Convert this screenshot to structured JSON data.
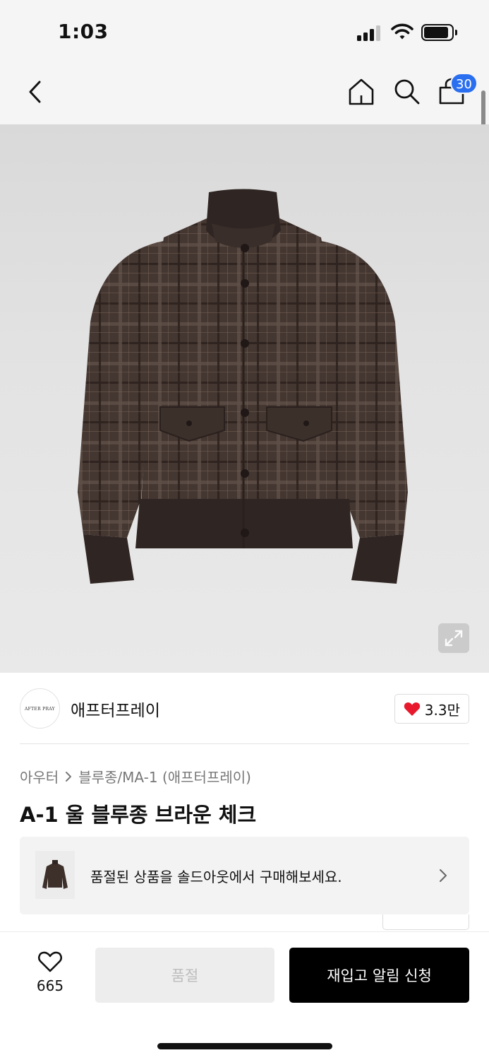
{
  "status_bar": {
    "time": "1:03"
  },
  "nav": {
    "cart_count": "30"
  },
  "brand": {
    "logo_text": "AFTER PRAY",
    "name": "애프터프레이",
    "like_count": "3.3만"
  },
  "breadcrumb": {
    "category": "아우터",
    "subcategory": "블루종/MA-1 (애프터프레이)"
  },
  "product": {
    "title": "A-1 울 블루종 브라운 체크"
  },
  "soldout_banner": {
    "text": "품절된 상품을 솔드아웃에서 구매해보세요."
  },
  "bottom_bar": {
    "wish_count": "665",
    "soldout_label": "품절",
    "restock_label": "재입고 알림 신청"
  },
  "colors": {
    "accent_badge": "#2a6ff0",
    "like_heart": "#e8192c",
    "primary_button": "#000000"
  },
  "icons": [
    "back-icon",
    "home-icon",
    "search-icon",
    "shopping-bag-icon",
    "expand-icon",
    "heart-icon",
    "chevron-right-icon",
    "heart-outline-icon"
  ]
}
